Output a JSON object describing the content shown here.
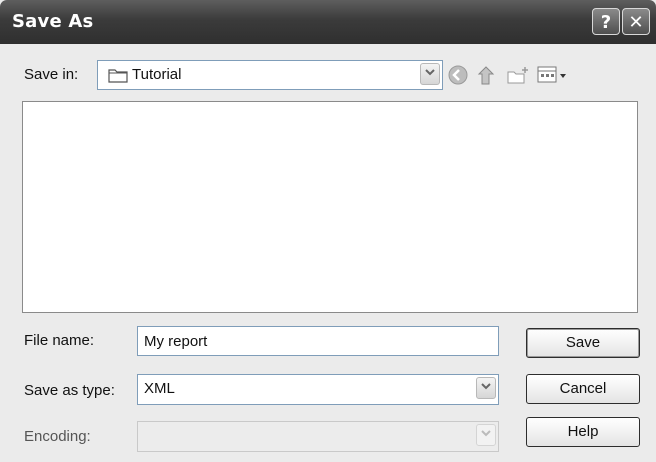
{
  "window": {
    "title": "Save As",
    "help_symbol": "?",
    "close_symbol": "✕"
  },
  "save_in": {
    "label": "Save in:",
    "value": "Tutorial"
  },
  "toolbar": {
    "back_icon": "back-icon",
    "up_icon": "up-folder-icon",
    "new_folder_icon": "new-folder-icon",
    "views_icon": "views-menu-icon"
  },
  "file_name": {
    "label": "File name:",
    "value": "My report"
  },
  "save_as_type": {
    "label": "Save as type:",
    "value": "XML"
  },
  "encoding": {
    "label": "Encoding:",
    "value": ""
  },
  "buttons": {
    "save": "Save",
    "cancel": "Cancel",
    "help": "Help"
  }
}
